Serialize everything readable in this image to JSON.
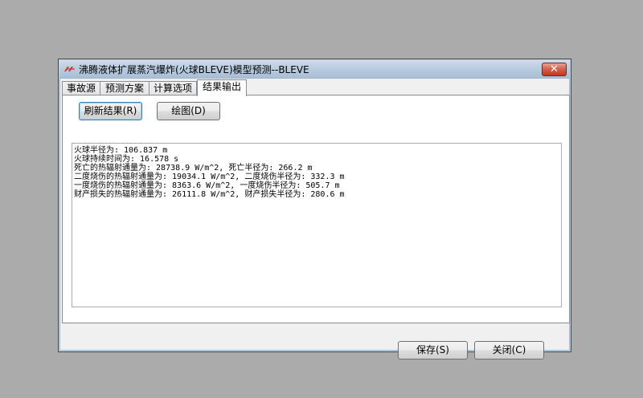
{
  "window": {
    "title": "沸腾液体扩展蒸汽爆炸(火球BLEVE)模型预测--BLEVE",
    "close_label": "✕"
  },
  "tabs": [
    {
      "label": "事故源",
      "active": false
    },
    {
      "label": "预测方案",
      "active": false
    },
    {
      "label": "计算选项",
      "active": false
    },
    {
      "label": "结果输出",
      "active": true
    }
  ],
  "toolbar": {
    "refresh_label": "刷新结果(R)",
    "plot_label": "绘图(D)"
  },
  "output": {
    "lines": [
      "火球半径为: 106.837 m",
      "火球持续时间为: 16.578 s",
      "死亡的热辐射通量为: 28738.9 W/m^2, 死亡半径为: 266.2 m",
      "二度烧伤的热辐射通量为: 19034.1 W/m^2, 二度烧伤半径为: 332.3 m",
      "一度烧伤的热辐射通量为: 8363.6 W/m^2, 一度烧伤半径为: 505.7 m",
      "财产损失的热辐射通量为: 26111.8 W/m^2, 财产损失半径为: 280.6 m"
    ]
  },
  "footer": {
    "save_label": "保存(S)",
    "close_label": "关闭(C)"
  },
  "colors": {
    "desktop": "#ababab",
    "frame": "#9fb6cf",
    "close_button": "#c2391f"
  },
  "icons": {
    "app": "app-logo-icon",
    "close": "close-icon"
  }
}
